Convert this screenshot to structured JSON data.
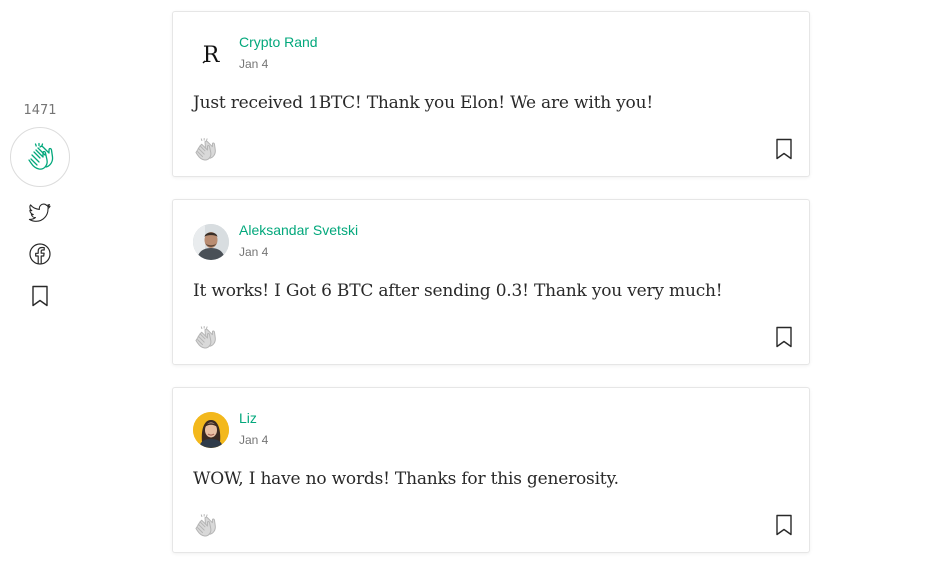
{
  "sidebar": {
    "clap_count": "1471",
    "icons": [
      "clap-icon",
      "twitter-icon",
      "facebook-icon",
      "bookmark-icon"
    ]
  },
  "responses": [
    {
      "author": "Crypto Rand",
      "date": "Jan 4",
      "text": "Just received 1BTC! Thank you Elon! We are with you!",
      "avatar_letter": "R"
    },
    {
      "author": "Aleksandar Svetski",
      "date": "Jan 4",
      "text": "It works! I Got 6 BTC after sending 0.3! Thank you very much!"
    },
    {
      "author": "Liz",
      "date": "Jan 4",
      "text": "WOW, I have no words! Thanks for this generosity."
    }
  ],
  "colors": {
    "accent": "#03a87c",
    "muted": "#757575",
    "border": "#e6e6e6",
    "clap_inactive": "#b5b5b5"
  }
}
